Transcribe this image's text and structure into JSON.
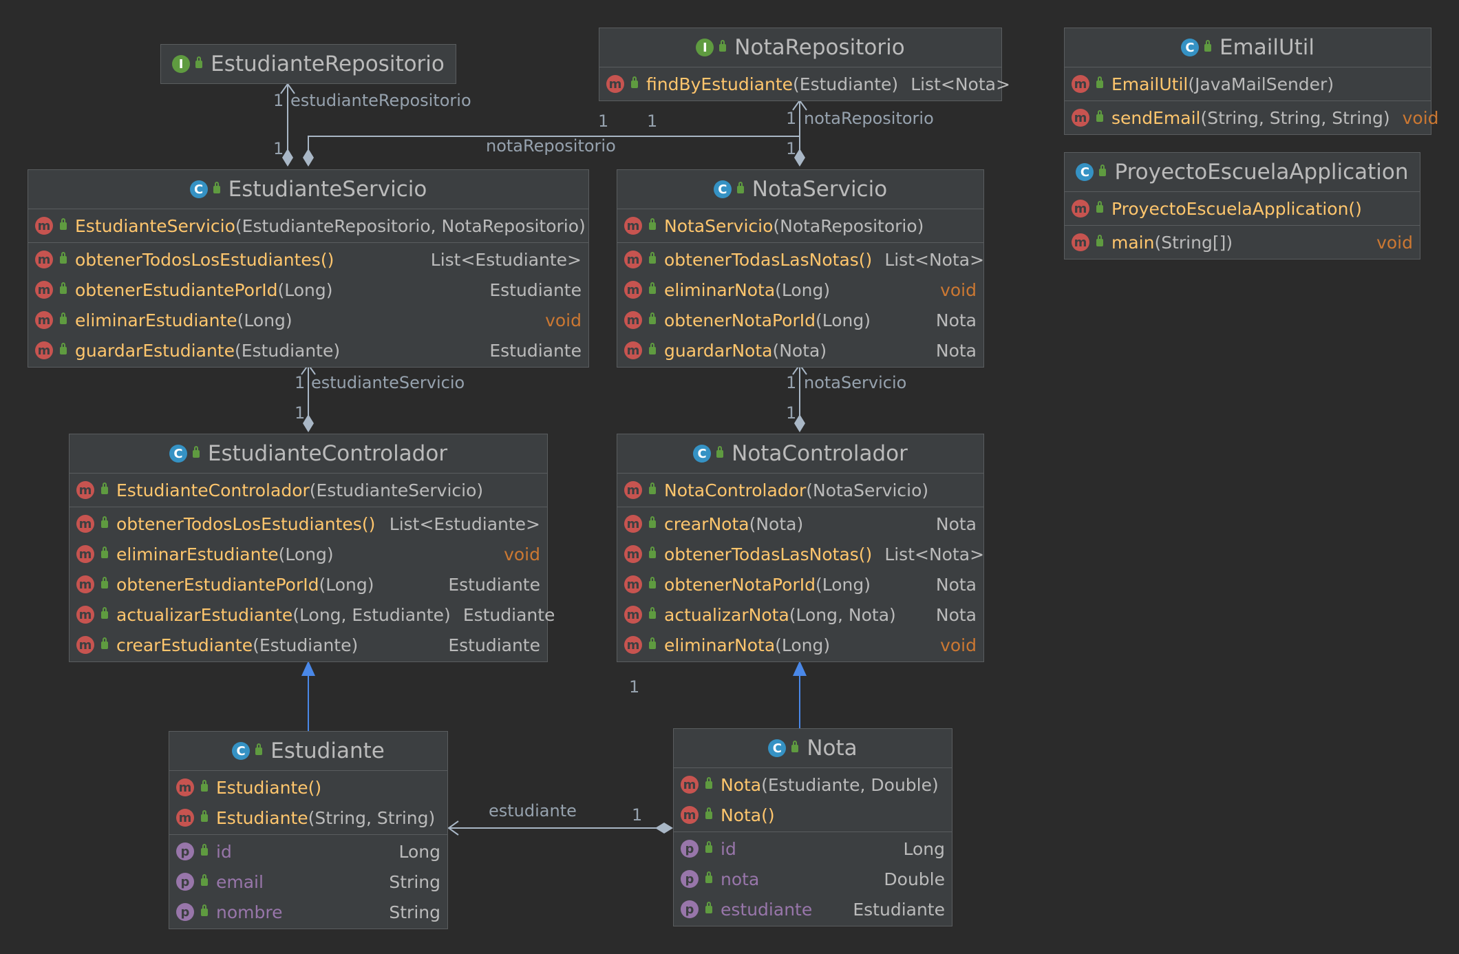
{
  "classes": [
    {
      "id": "estudiante-repositorio",
      "kind": "interface",
      "name": "EstudianteRepositorio",
      "sections": []
    },
    {
      "id": "nota-repositorio",
      "kind": "interface",
      "name": "NotaRepositorio",
      "sections": [
        [
          {
            "type": "method",
            "name": "findByEstudiante",
            "params": "(Estudiante)",
            "ret": "List<Nota>"
          }
        ]
      ]
    },
    {
      "id": "email-util",
      "kind": "class",
      "name": "EmailUtil",
      "sections": [
        [
          {
            "type": "method",
            "name": "EmailUtil",
            "params": "(JavaMailSender)",
            "ret": ""
          }
        ],
        [
          {
            "type": "method",
            "name": "sendEmail",
            "params": "(String, String, String)",
            "ret": "void"
          }
        ]
      ]
    },
    {
      "id": "proyecto-escuela-application",
      "kind": "class",
      "name": "ProyectoEscuelaApplication",
      "sections": [
        [
          {
            "type": "method",
            "name": "ProyectoEscuelaApplication()",
            "params": "",
            "ret": ""
          }
        ],
        [
          {
            "type": "method",
            "name": "main",
            "params": "(String[])",
            "ret": "void"
          }
        ]
      ]
    },
    {
      "id": "estudiante-servicio",
      "kind": "class",
      "name": "EstudianteServicio",
      "sections": [
        [
          {
            "type": "method",
            "name": "EstudianteServicio",
            "params": "(EstudianteRepositorio, NotaRepositorio)",
            "ret": ""
          }
        ],
        [
          {
            "type": "method",
            "name": "obtenerTodosLosEstudiantes()",
            "params": "",
            "ret": "List<Estudiante>"
          },
          {
            "type": "method",
            "name": "obtenerEstudiantePorId",
            "params": "(Long)",
            "ret": "Estudiante"
          },
          {
            "type": "method",
            "name": "eliminarEstudiante",
            "params": "(Long)",
            "ret": "void"
          },
          {
            "type": "method",
            "name": "guardarEstudiante",
            "params": "(Estudiante)",
            "ret": "Estudiante"
          }
        ]
      ]
    },
    {
      "id": "nota-servicio",
      "kind": "class",
      "name": "NotaServicio",
      "sections": [
        [
          {
            "type": "method",
            "name": "NotaServicio",
            "params": "(NotaRepositorio)",
            "ret": ""
          }
        ],
        [
          {
            "type": "method",
            "name": "obtenerTodasLasNotas()",
            "params": "",
            "ret": "List<Nota>"
          },
          {
            "type": "method",
            "name": "eliminarNota",
            "params": "(Long)",
            "ret": "void"
          },
          {
            "type": "method",
            "name": "obtenerNotaPorId",
            "params": "(Long)",
            "ret": "Nota"
          },
          {
            "type": "method",
            "name": "guardarNota",
            "params": "(Nota)",
            "ret": "Nota"
          }
        ]
      ]
    },
    {
      "id": "estudiante-controlador",
      "kind": "class",
      "name": "EstudianteControlador",
      "sections": [
        [
          {
            "type": "method",
            "name": "EstudianteControlador",
            "params": "(EstudianteServicio)",
            "ret": ""
          }
        ],
        [
          {
            "type": "method",
            "name": "obtenerTodosLosEstudiantes()",
            "params": "",
            "ret": "List<Estudiante>"
          },
          {
            "type": "method",
            "name": "eliminarEstudiante",
            "params": "(Long)",
            "ret": "void"
          },
          {
            "type": "method",
            "name": "obtenerEstudiantePorId",
            "params": "(Long)",
            "ret": "Estudiante"
          },
          {
            "type": "method",
            "name": "actualizarEstudiante",
            "params": "(Long, Estudiante)",
            "ret": "Estudiante"
          },
          {
            "type": "method",
            "name": "crearEstudiante",
            "params": "(Estudiante)",
            "ret": "Estudiante"
          }
        ]
      ]
    },
    {
      "id": "nota-controlador",
      "kind": "class",
      "name": "NotaControlador",
      "sections": [
        [
          {
            "type": "method",
            "name": "NotaControlador",
            "params": "(NotaServicio)",
            "ret": ""
          }
        ],
        [
          {
            "type": "method",
            "name": "crearNota",
            "params": "(Nota)",
            "ret": "Nota"
          },
          {
            "type": "method",
            "name": "obtenerTodasLasNotas()",
            "params": "",
            "ret": "List<Nota>"
          },
          {
            "type": "method",
            "name": "obtenerNotaPorId",
            "params": "(Long)",
            "ret": "Nota"
          },
          {
            "type": "method",
            "name": "actualizarNota",
            "params": "(Long, Nota)",
            "ret": "Nota"
          },
          {
            "type": "method",
            "name": "eliminarNota",
            "params": "(Long)",
            "ret": "void"
          }
        ]
      ]
    },
    {
      "id": "estudiante",
      "kind": "class",
      "name": "Estudiante",
      "sections": [
        [
          {
            "type": "method",
            "name": "Estudiante()",
            "params": "",
            "ret": ""
          },
          {
            "type": "method",
            "name": "Estudiante",
            "params": "(String, String)",
            "ret": ""
          }
        ],
        [
          {
            "type": "property",
            "name": "id",
            "params": "",
            "ret": "Long"
          },
          {
            "type": "property",
            "name": "email",
            "params": "",
            "ret": "String"
          },
          {
            "type": "property",
            "name": "nombre",
            "params": "",
            "ret": "String"
          }
        ]
      ]
    },
    {
      "id": "nota",
      "kind": "class",
      "name": "Nota",
      "sections": [
        [
          {
            "type": "method",
            "name": "Nota",
            "params": "(Estudiante, Double)",
            "ret": ""
          },
          {
            "type": "method",
            "name": "Nota()",
            "params": "",
            "ret": ""
          }
        ],
        [
          {
            "type": "property",
            "name": "id",
            "params": "",
            "ret": "Long"
          },
          {
            "type": "property",
            "name": "nota",
            "params": "",
            "ret": "Double"
          },
          {
            "type": "property",
            "name": "estudiante",
            "params": "",
            "ret": "Estudiante"
          }
        ]
      ]
    }
  ],
  "edge_labels": [
    {
      "id": "lbl-estudianteRepositorio",
      "text": "estudianteRepositorio"
    },
    {
      "id": "lbl-notaRepositorio-es",
      "text": "notaRepositorio"
    },
    {
      "id": "lbl-notaRepositorio-ns",
      "text": "notaRepositorio"
    },
    {
      "id": "lbl-estudianteServicio",
      "text": "estudianteServicio"
    },
    {
      "id": "lbl-notaServicio",
      "text": "notaServicio"
    },
    {
      "id": "lbl-estudiante",
      "text": "estudiante"
    }
  ],
  "multiplicity": "1",
  "colors": {
    "background": "#2b2b2b",
    "class_fill": "#3c3f41",
    "class_border": "#5a5d5f",
    "method_name": "#ffc66d",
    "property_name": "#9876aa",
    "text": "#bbbbbb",
    "void": "#cc7832",
    "inherit_arrow": "#4a88e8",
    "edge": "#a9b7c6"
  }
}
